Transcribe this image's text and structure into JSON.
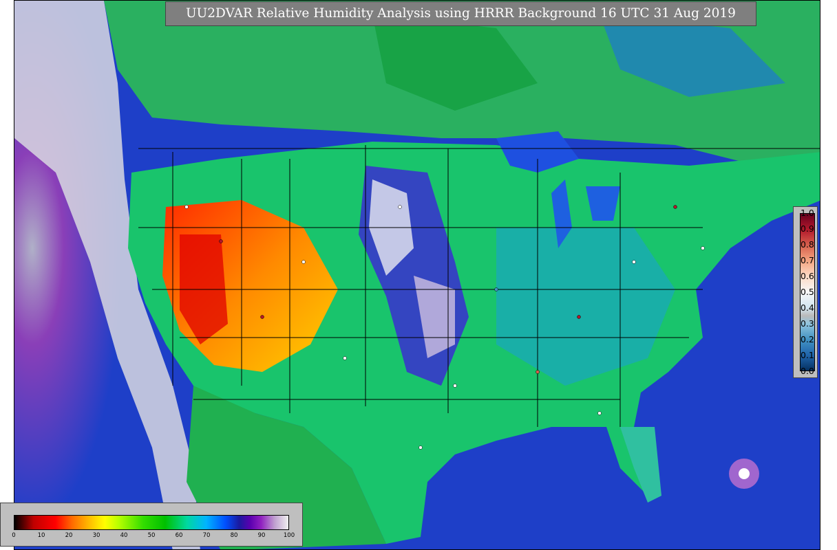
{
  "title": "UU2DVAR Relative Humidity Analysis using HRRR Background 16 UTC 31 Aug 2019",
  "obs_legend": {
    "ticks": [
      "1.0",
      "0.9",
      "0.8",
      "0.7",
      "0.6",
      "0.5",
      "0.4",
      "0.3",
      "0.2",
      "0.1",
      "0.0"
    ]
  },
  "rh_colorbar": {
    "ticks": [
      "0",
      "10",
      "20",
      "30",
      "40",
      "50",
      "60",
      "70",
      "80",
      "90",
      "100"
    ]
  },
  "colors": {
    "ocean": "#1e3fc8",
    "land_moist": "#00c000",
    "land_dry": "#ff0000",
    "saturated": "#f0f0f0",
    "very_humid": "#7a1fa8",
    "title_box": "#7f7f7f",
    "legend_box": "#bfbfbf"
  }
}
